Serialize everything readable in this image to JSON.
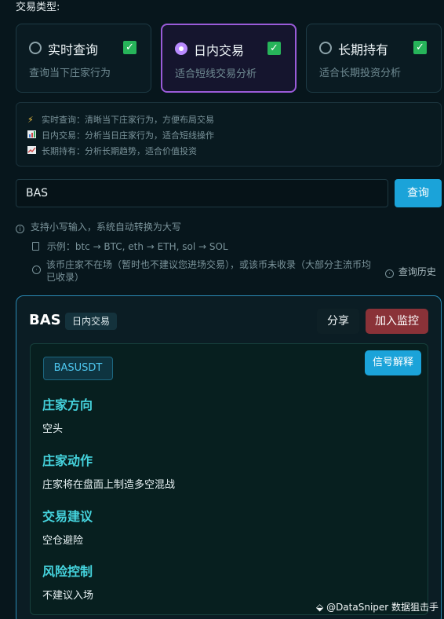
{
  "type_label": "交易类型:",
  "modes": [
    {
      "title": "实时查询",
      "desc": "查询当下庄家行为",
      "selected": false
    },
    {
      "title": "日内交易",
      "desc": "适合短线交易分析",
      "selected": true
    },
    {
      "title": "长期持有",
      "desc": "适合长期投资分析",
      "selected": false
    }
  ],
  "info": [
    {
      "icon": "lightning-icon",
      "text": "实时查询：清晰当下庄家行为，方便布局交易"
    },
    {
      "icon": "bar-chart-icon",
      "text": "日内交易：分析当日庄家行为，适合短线操作"
    },
    {
      "icon": "trend-chart-icon",
      "text": "长期持有：分析长期趋势，适合价值投资"
    }
  ],
  "search": {
    "value": "BAS",
    "button": "查询"
  },
  "hints": {
    "case": "支持小写输入，系统自动转换为大写",
    "example": "示例：btc → BTC, eth → ETH, sol → SOL",
    "warning": "该币庄家不在场（暂时也不建议您进场交易），或该币未收录（大部分主流币均已收录）",
    "history": "查询历史"
  },
  "result": {
    "symbol": "BAS",
    "mode_tag": "日内交易",
    "share": "分享",
    "monitor": "加入监控",
    "pair": "BASUSDT",
    "explain": "信号解释",
    "sections": [
      {
        "title": "庄家方向",
        "text": "空头"
      },
      {
        "title": "庄家动作",
        "text": "庄家将在盘面上制造多空混战"
      },
      {
        "title": "交易建议",
        "text": "空仓避险"
      },
      {
        "title": "风险控制",
        "text": "不建议入场"
      }
    ]
  },
  "watermark": "@DataSniper 数据狙击手"
}
